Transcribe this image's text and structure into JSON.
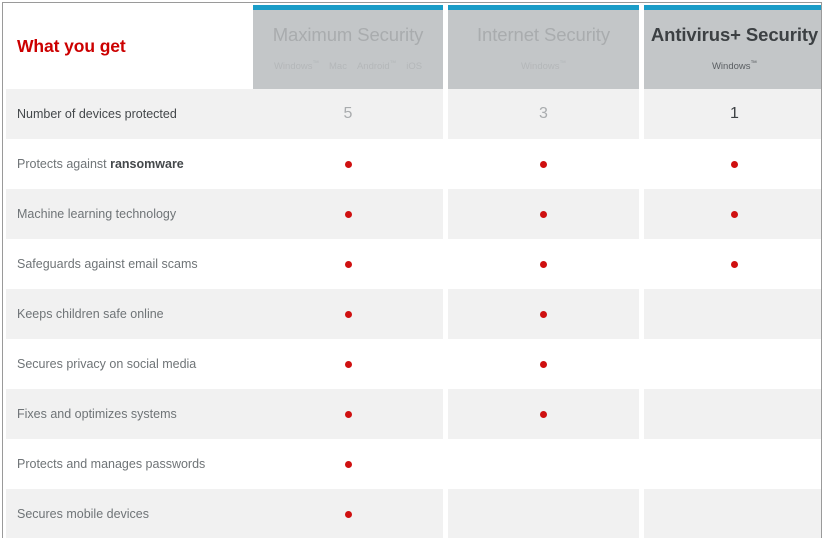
{
  "table": {
    "feature_header": "What you get",
    "accent_color": "#cc0000",
    "bar_color": "#1b9dc8",
    "dot_color": "#cf1010",
    "columns": [
      {
        "name": "Maximum Security",
        "platforms": [
          "Windows™",
          "Mac",
          "Android™",
          "iOS"
        ],
        "platforms_text": "Windows™   Mac   Android™   iOS",
        "state": "dim",
        "devices": "5"
      },
      {
        "name": "Internet Security",
        "platforms": [
          "Windows™"
        ],
        "platforms_text": "Windows™",
        "state": "dim",
        "devices": "3"
      },
      {
        "name": "Antivirus+ Security",
        "platforms": [
          "Windows™"
        ],
        "platforms_text": "Windows™",
        "state": "active",
        "devices": "1"
      }
    ],
    "rows": [
      {
        "label": "Number of devices protected",
        "label_prefix": "Number of devices protected",
        "label_bold": "",
        "label_suffix": "",
        "type": "value",
        "emphasis": true,
        "values": [
          "5",
          "3",
          "1"
        ],
        "marks": [
          false,
          false,
          false
        ]
      },
      {
        "label": "Protects against ransomware",
        "label_prefix": "Protects against ",
        "label_bold": "ransomware",
        "label_suffix": "",
        "type": "dots",
        "emphasis": false,
        "values": [
          "",
          "",
          ""
        ],
        "marks": [
          true,
          true,
          true
        ]
      },
      {
        "label": "Machine learning technology",
        "label_prefix": "Machine learning technology",
        "label_bold": "",
        "label_suffix": "",
        "type": "dots",
        "emphasis": false,
        "values": [
          "",
          "",
          ""
        ],
        "marks": [
          true,
          true,
          true
        ]
      },
      {
        "label": "Safeguards against email scams",
        "label_prefix": "Safeguards against email scams",
        "label_bold": "",
        "label_suffix": "",
        "type": "dots",
        "emphasis": false,
        "values": [
          "",
          "",
          ""
        ],
        "marks": [
          true,
          true,
          true
        ]
      },
      {
        "label": "Keeps children safe online",
        "label_prefix": "Keeps children safe online",
        "label_bold": "",
        "label_suffix": "",
        "type": "dots",
        "emphasis": false,
        "values": [
          "",
          "",
          ""
        ],
        "marks": [
          true,
          true,
          false
        ]
      },
      {
        "label": "Secures privacy on social media",
        "label_prefix": "Secures privacy on social media",
        "label_bold": "",
        "label_suffix": "",
        "type": "dots",
        "emphasis": false,
        "values": [
          "",
          "",
          ""
        ],
        "marks": [
          true,
          true,
          false
        ]
      },
      {
        "label": "Fixes and optimizes systems",
        "label_prefix": "Fixes and optimizes systems",
        "label_bold": "",
        "label_suffix": "",
        "type": "dots",
        "emphasis": false,
        "values": [
          "",
          "",
          ""
        ],
        "marks": [
          true,
          true,
          false
        ]
      },
      {
        "label": "Protects and manages passwords",
        "label_prefix": "Protects and manages passwords",
        "label_bold": "",
        "label_suffix": "",
        "type": "dots",
        "emphasis": false,
        "values": [
          "",
          "",
          ""
        ],
        "marks": [
          true,
          false,
          false
        ]
      },
      {
        "label": "Secures mobile devices",
        "label_prefix": "Secures mobile devices",
        "label_bold": "",
        "label_suffix": "",
        "type": "dots",
        "emphasis": false,
        "values": [
          "",
          "",
          ""
        ],
        "marks": [
          true,
          false,
          false
        ]
      }
    ]
  }
}
